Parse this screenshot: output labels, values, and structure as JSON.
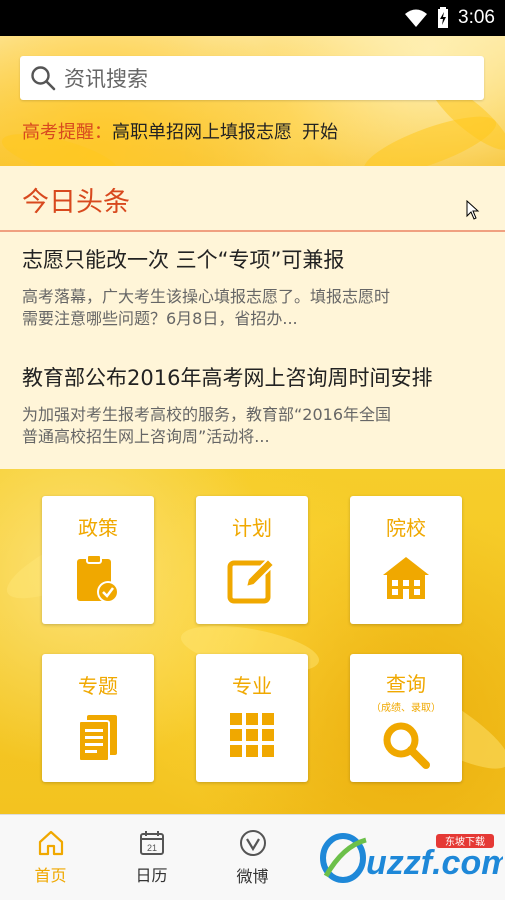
{
  "status_bar": {
    "time": "3:06"
  },
  "search": {
    "placeholder": "资讯搜索"
  },
  "reminder": {
    "label": "高考提醒：",
    "text": "高职单招网上填报志愿",
    "action": "开始"
  },
  "news": {
    "section_title": "今日头条",
    "items": [
      {
        "title": "志愿只能改一次 三个“专项”可兼报",
        "desc_line1": "高考落幕，广大考生该操心填报志愿了。填报志愿时",
        "desc_line2": "需要注意哪些问题？6月8日，省招办..."
      },
      {
        "title": "教育部公布2016年高考网上咨询周时间安排",
        "desc_line1": "为加强对考生报考高校的服务，教育部“2016年全国",
        "desc_line2": "普通高校招生网上咨询周”活动将..."
      }
    ]
  },
  "grid": {
    "items": [
      {
        "label": "政策",
        "icon": "clipboard-check-icon"
      },
      {
        "label": "计划",
        "icon": "edit-icon"
      },
      {
        "label": "院校",
        "icon": "school-icon"
      },
      {
        "label": "专题",
        "icon": "document-icon"
      },
      {
        "label": "专业",
        "icon": "grid-icon"
      },
      {
        "label": "查询",
        "sublabel": "（成绩、录取）",
        "icon": "search-icon"
      }
    ]
  },
  "nav": {
    "items": [
      {
        "label": "首页",
        "icon": "home-icon",
        "active": true
      },
      {
        "label": "日历",
        "icon": "calendar-icon",
        "icon_text": "21"
      },
      {
        "label": "微博",
        "icon": "weibo-icon"
      }
    ]
  },
  "watermark": {
    "text": "uzzf.com",
    "sub": "东坡下载"
  },
  "colors": {
    "accent": "#f0a800",
    "headline": "#d8491e",
    "background": "#f6c21a"
  }
}
